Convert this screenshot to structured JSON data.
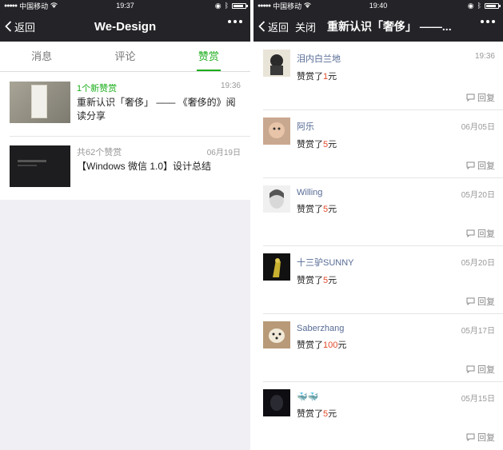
{
  "left": {
    "status": {
      "carrier": "中国移动",
      "time": "19:37"
    },
    "nav": {
      "back": "返回",
      "title": "We-Design"
    },
    "tabs": [
      "消息",
      "评论",
      "赞赏"
    ],
    "items": [
      {
        "count": "1个新赞赏",
        "time": "19:36",
        "title": "重新认识「奢侈」 —— 《奢侈的》阅读分享"
      },
      {
        "count": "共62个赞赏",
        "time": "06月19日",
        "title": "【Windows 微信 1.0】设计总结"
      }
    ]
  },
  "right": {
    "status": {
      "carrier": "中国移动",
      "time": "19:40"
    },
    "nav": {
      "back": "返回",
      "close": "关闭",
      "title": "重新认识「奢侈」 ——..."
    },
    "reply_label": "回复",
    "rewards": [
      {
        "name": "泪内白兰地",
        "prefix": "赞赏了",
        "amount": "1",
        "unit": "元",
        "time": "19:36"
      },
      {
        "name": "阿乐",
        "prefix": "赞赏了",
        "amount": "5",
        "unit": "元",
        "time": "06月05日"
      },
      {
        "name": "Willing",
        "prefix": "赞赏了",
        "amount": "5",
        "unit": "元",
        "time": "05月20日"
      },
      {
        "name": "十三驴SUNNY",
        "prefix": "赞赏了",
        "amount": "5",
        "unit": "元",
        "time": "05月20日"
      },
      {
        "name": "Saberzhang",
        "prefix": "赞赏了",
        "amount": "100",
        "unit": "元",
        "time": "05月17日"
      },
      {
        "name": "",
        "prefix": "赞赏了",
        "amount": "5",
        "unit": "元",
        "time": "05月15日"
      }
    ]
  },
  "colors": {
    "accent": "#1aad19",
    "nav_bg": "#232328",
    "name": "#576b95",
    "amount": "#e04a2a"
  }
}
